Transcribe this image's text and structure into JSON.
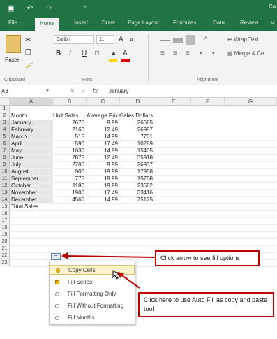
{
  "titlebar": {
    "save_icon": "save-icon",
    "undo_icon": "undo-icon",
    "redo_icon": "redo-icon",
    "right_char": "Ca"
  },
  "tabs": [
    {
      "label": "File"
    },
    {
      "label": "Home"
    },
    {
      "label": "Insert"
    },
    {
      "label": "Draw"
    },
    {
      "label": "Page Layout"
    },
    {
      "label": "Formulas"
    },
    {
      "label": "Data"
    },
    {
      "label": "Review"
    },
    {
      "label": "V"
    }
  ],
  "ribbon": {
    "paste": "Paste",
    "clipboard": "Clipboard",
    "font_name": "Calibri",
    "font_size": "11",
    "grow": "A",
    "shrink": "A",
    "bold": "B",
    "italic": "I",
    "underline": "U",
    "font_group": "Font",
    "alignment_group": "Alignment",
    "wrap": "Wrap Text",
    "merge": "Merge & Ce"
  },
  "formula_bar": {
    "name_box": "A3",
    "fx": "fx",
    "value": "January"
  },
  "columns": [
    "A",
    "B",
    "C",
    "D",
    "E",
    "F",
    "G"
  ],
  "rows": [
    "1",
    "2",
    "3",
    "4",
    "5",
    "6",
    "7",
    "8",
    "9",
    "10",
    "11",
    "12",
    "13",
    "14",
    "15",
    "16",
    "17",
    "18",
    "19",
    "20",
    "21",
    "22",
    "23"
  ],
  "table": {
    "headers": [
      "Month",
      "Unit Sales",
      "Average Price",
      "Sales Dollars"
    ],
    "data": [
      [
        "January",
        "2670",
        "9.99",
        "26685"
      ],
      [
        "February",
        "2160",
        "12.49",
        "26987"
      ],
      [
        "March",
        "515",
        "14.99",
        "7701"
      ],
      [
        "April",
        "590",
        "17.49",
        "10289"
      ],
      [
        "May",
        "1030",
        "14.99",
        "15405"
      ],
      [
        "June",
        "2875",
        "12.49",
        "35918"
      ],
      [
        "July",
        "2700",
        "9.99",
        "26937"
      ],
      [
        "August",
        "900",
        "19.99",
        "17958"
      ],
      [
        "September",
        "775",
        "19.99",
        "15708"
      ],
      [
        "October",
        "1180",
        "19.99",
        "23562"
      ],
      [
        "November",
        "1900",
        "17.49",
        "33416"
      ],
      [
        "December",
        "4560",
        "14.99",
        "75125"
      ]
    ],
    "total_label": "Total Sales"
  },
  "callouts": {
    "top": "Click arrow to see fill options",
    "bottom": "Click here to use Auto Fill as copy and paste tool"
  },
  "fill_menu": [
    {
      "label": "Copy Cells"
    },
    {
      "label": "Fill Series"
    },
    {
      "label": "Fill Formatting Only"
    },
    {
      "label": "Fill Without Formatting"
    },
    {
      "label": "Fill Months"
    }
  ],
  "colors": {
    "excel_green": "#217346",
    "callout_red": "#c00000",
    "highlight": "#fff2cc"
  }
}
